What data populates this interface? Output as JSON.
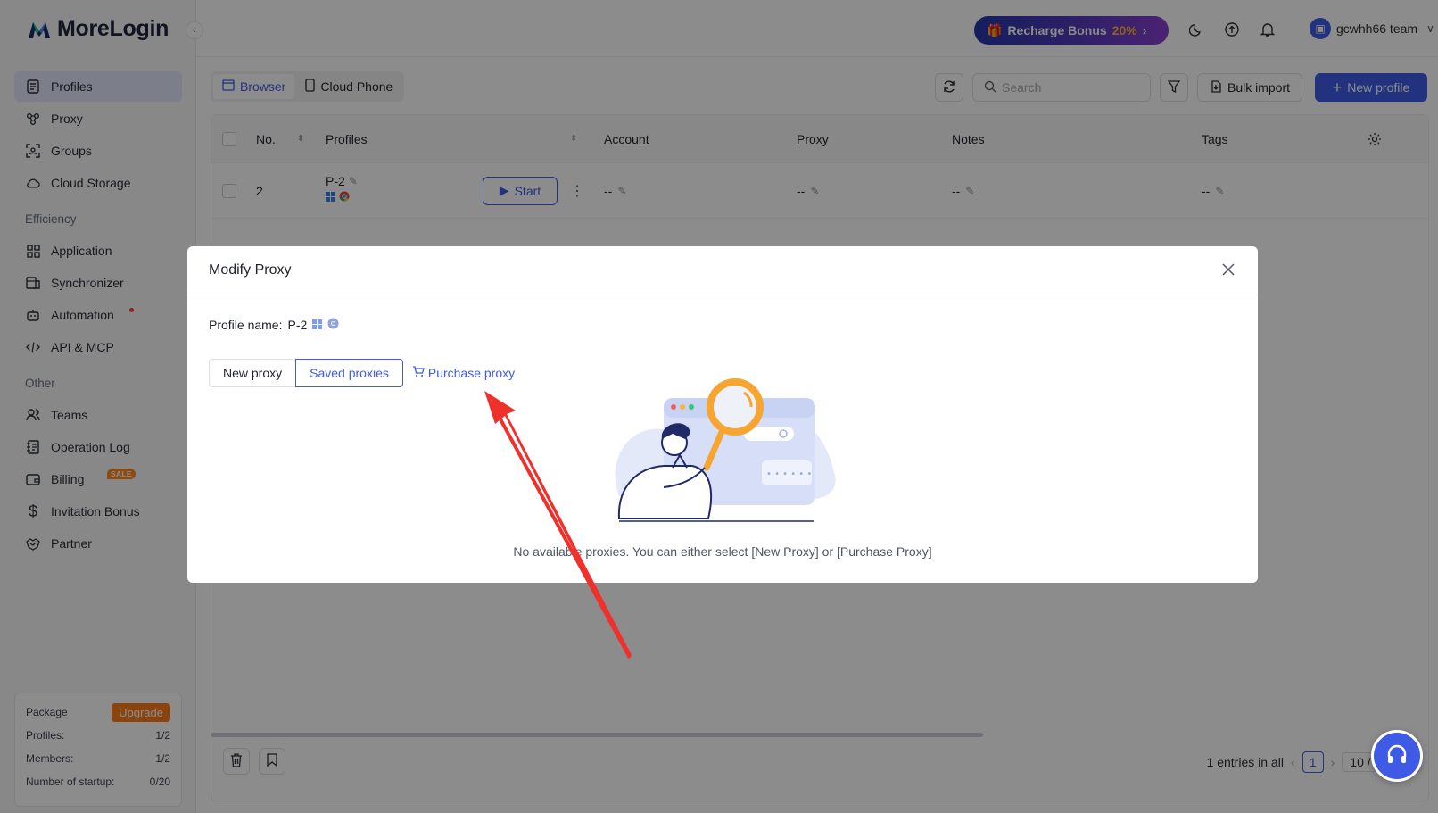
{
  "app": {
    "brand": "MoreLogin",
    "collapse_icon": "chevron-left-icon"
  },
  "sidebar": {
    "items_main": [
      {
        "label": "Profiles",
        "icon": "document-icon",
        "active": true
      },
      {
        "label": "Proxy",
        "icon": "proxy-icon"
      },
      {
        "label": "Groups",
        "icon": "groups-icon"
      },
      {
        "label": "Cloud Storage",
        "icon": "cloud-icon"
      }
    ],
    "section_efficiency": "Efficiency",
    "items_efficiency": [
      {
        "label": "Application",
        "icon": "grid-icon"
      },
      {
        "label": "Synchronizer",
        "icon": "sync-window-icon"
      },
      {
        "label": "Automation",
        "icon": "robot-icon"
      },
      {
        "label": "API & MCP",
        "icon": "code-icon"
      }
    ],
    "section_other": "Other",
    "items_other": [
      {
        "label": "Teams",
        "icon": "team-icon"
      },
      {
        "label": "Operation Log",
        "icon": "log-icon"
      },
      {
        "label": "Billing",
        "icon": "wallet-icon",
        "badge": "SALE"
      },
      {
        "label": "Invitation Bonus",
        "icon": "dollar-icon"
      },
      {
        "label": "Partner",
        "icon": "handshake-icon"
      }
    ],
    "package": {
      "title": "Package",
      "upgrade": "Upgrade",
      "rows": [
        {
          "label": "Profiles:",
          "value": "1/2"
        },
        {
          "label": "Members:",
          "value": "1/2"
        },
        {
          "label": "Number of startup:",
          "value": "0/20"
        }
      ]
    }
  },
  "topbar": {
    "recharge_label": "Recharge Bonus",
    "recharge_pct": "20%",
    "user_name": "gcwhh66 team"
  },
  "toolbar": {
    "tab_browser": "Browser",
    "tab_cloud_phone": "Cloud Phone",
    "search_placeholder": "Search",
    "bulk_import": "Bulk import",
    "new_profile": "New profile"
  },
  "table": {
    "headers": {
      "no": "No.",
      "profiles": "Profiles",
      "account": "Account",
      "proxy": "Proxy",
      "notes": "Notes",
      "tags": "Tags"
    },
    "rows": [
      {
        "no": "2",
        "profile": "P-2",
        "start": "Start",
        "account": "--",
        "proxy": "--",
        "notes": "--",
        "tags": "--"
      }
    ]
  },
  "footer": {
    "entries": "1 entries in all",
    "page": "1",
    "page_size": "10 / page"
  },
  "modal": {
    "title": "Modify Proxy",
    "profile_name_label": "Profile name:",
    "profile_name_value": "P-2",
    "tab_new": "New proxy",
    "tab_saved": "Saved proxies",
    "purchase": "Purchase proxy",
    "empty_text": "No available proxies. You can either select [New Proxy] or [Purchase Proxy]"
  },
  "colors": {
    "accent": "#3f5be6",
    "annotation_arrow": "#f0302a",
    "upgrade": "#ff7d1a"
  }
}
